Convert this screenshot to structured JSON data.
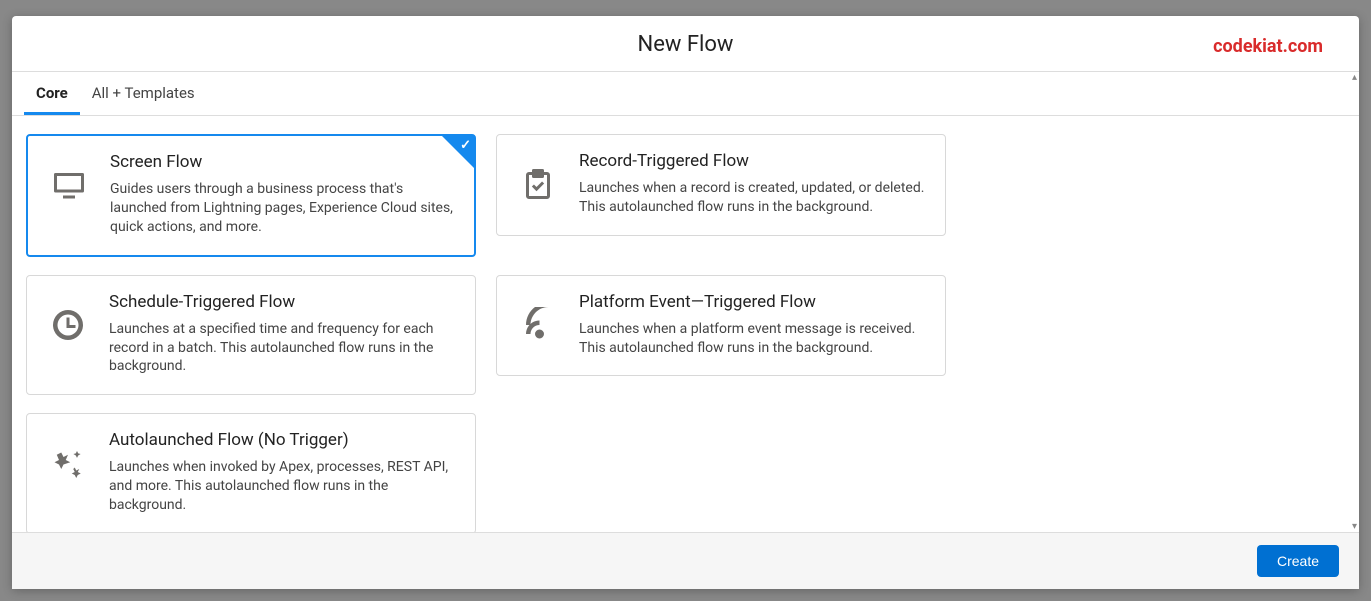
{
  "header": {
    "title": "New Flow",
    "brand": "codekiat.com"
  },
  "tabs": [
    {
      "label": "Core",
      "active": true
    },
    {
      "label": "All + Templates",
      "active": false
    }
  ],
  "cards": {
    "screenFlow": {
      "title": "Screen Flow",
      "desc": "Guides users through a business process that's launched from Lightning pages, Experience Cloud sites, quick actions, and more."
    },
    "recordTriggered": {
      "title": "Record-Triggered Flow",
      "desc": "Launches when a record is created, updated, or deleted. This autolaunched flow runs in the background."
    },
    "scheduleTriggered": {
      "title": "Schedule-Triggered Flow",
      "desc": "Launches at a specified time and frequency for each record in a batch. This autolaunched flow runs in the background."
    },
    "platformEvent": {
      "title": "Platform Event—Triggered Flow",
      "desc": "Launches when a platform event message is received. This autolaunched flow runs in the background."
    },
    "autolaunched": {
      "title": "Autolaunched Flow (No Trigger)",
      "desc": "Launches when invoked by Apex, processes, REST API, and more. This autolaunched flow runs in the background."
    }
  },
  "footer": {
    "createLabel": "Create"
  }
}
